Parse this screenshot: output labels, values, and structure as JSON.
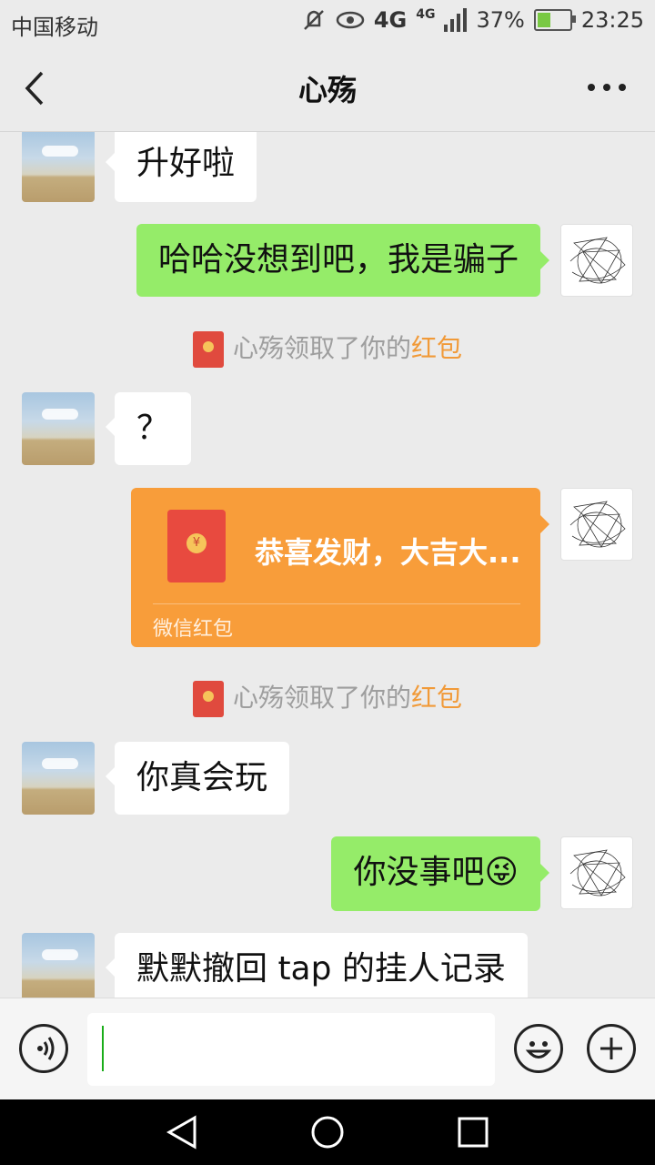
{
  "status_bar": {
    "carrier": "中国移动",
    "network_a": "4G",
    "network_b": "4G",
    "battery": "37%",
    "time": "23:25",
    "icons": [
      "mute-icon",
      "eye-icon",
      "signal-icon",
      "battery-icon"
    ]
  },
  "header": {
    "title": "心殇",
    "back_icon": "chevron-left-icon",
    "more_icon": "more-icon"
  },
  "messages": [
    {
      "side": "in",
      "text": "升好啦"
    },
    {
      "side": "out",
      "text": "哈哈没想到吧，我是骗子"
    },
    {
      "type": "system",
      "text": "心殇领取了你的",
      "highlight": "红包"
    },
    {
      "side": "in",
      "text": "？"
    },
    {
      "type": "red_packet",
      "side": "out",
      "title": "恭喜发财，大吉大...",
      "footer": "微信红包"
    },
    {
      "type": "system",
      "text": "心殇领取了你的",
      "highlight": "红包"
    },
    {
      "side": "in",
      "text": "你真会玩"
    },
    {
      "side": "out",
      "text": "你没事吧",
      "emoji": "😜"
    },
    {
      "side": "in",
      "text": "默默撤回 tap 的挂人记录"
    }
  ],
  "input_bar": {
    "value": "",
    "voice_icon": "voice-icon",
    "emoji_icon": "emoji-icon",
    "add_icon": "add-icon"
  },
  "nav_bar": {
    "icons": [
      "back-triangle-icon",
      "home-circle-icon",
      "recents-square-icon"
    ]
  },
  "colors": {
    "background": "#ebebeb",
    "outgoing_bubble": "#95ec69",
    "incoming_bubble": "#ffffff",
    "red_packet": "#f89d3a",
    "highlight": "#f19a38"
  }
}
